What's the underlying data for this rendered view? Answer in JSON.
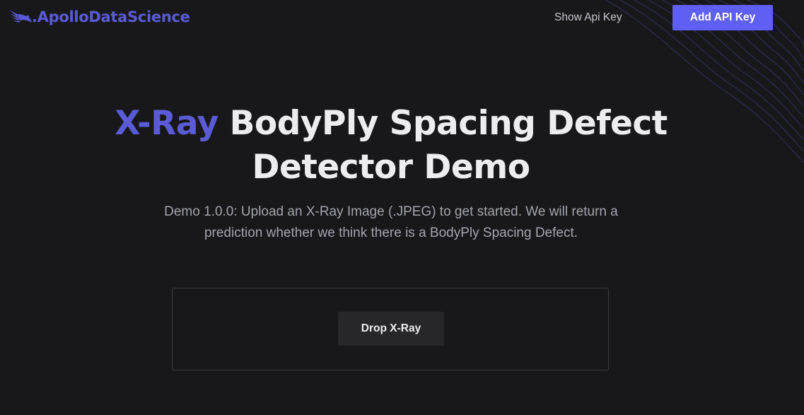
{
  "header": {
    "brand": ".ApolloDataScience",
    "brand_icon": "winged-logo-icon",
    "show_key_label": "Show Api Key",
    "add_key_label": "Add API Key"
  },
  "hero": {
    "title_accent": "X-Ray",
    "title_rest": " BodyPly Spacing Defect Detector Demo",
    "subtitle": "Demo 1.0.0: Upload an X-Ray Image (.JPEG) to get started. We will return a prediction whether we think there is a BodyPly Spacing Defect."
  },
  "dropzone": {
    "button_label": "Drop X-Ray"
  },
  "colors": {
    "background": "#18181b",
    "accent": "#5b5bd6",
    "primary_button": "#5f5ff4",
    "secondary_button": "#27272a"
  }
}
